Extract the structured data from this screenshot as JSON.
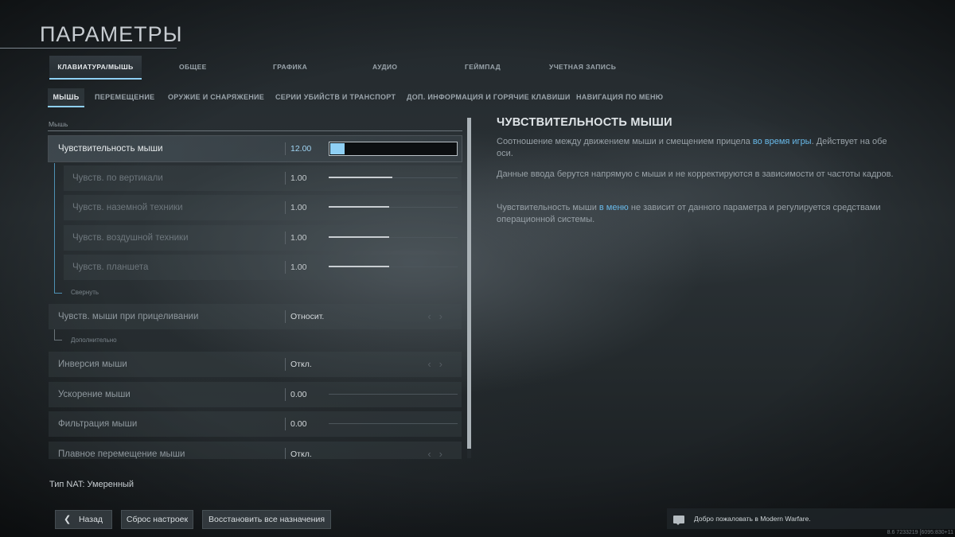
{
  "page_title": "ПАРАМЕТРЫ",
  "tabs": [
    "КЛАВИАТУРА/МЫШЬ",
    "ОБЩЕЕ",
    "ГРАФИКА",
    "АУДИО",
    "ГЕЙМПАД",
    "УЧЕТНАЯ ЗАПИСЬ"
  ],
  "active_tab": "КЛАВИАТУРА/МЫШЬ",
  "subtabs": [
    "МЫШЬ",
    "ПЕРЕМЕЩЕНИЕ",
    "ОРУЖИЕ И СНАРЯЖЕНИЕ",
    "СЕРИИ УБИЙСТВ И ТРАНСПОРТ",
    "ДОП. ИНФОРМАЦИЯ И ГОРЯЧИЕ КЛАВИШИ",
    "НАВИГАЦИЯ ПО МЕНЮ"
  ],
  "active_subtab": "МЫШЬ",
  "section_label": "Мышь",
  "settings": {
    "mouse_sensitivity": {
      "label": "Чувствительность мыши",
      "value": "12.00",
      "level": 0.11
    },
    "vertical": {
      "label": "Чувств. по вертикали",
      "value": "1.00",
      "level": 0.5
    },
    "ground_vehicle": {
      "label": "Чувств. наземной техники",
      "value": "1.00",
      "level": 0.47
    },
    "air_vehicle": {
      "label": "Чувств. воздушной техники",
      "value": "1.00",
      "level": 0.47
    },
    "tablet": {
      "label": "Чувств. планшета",
      "value": "1.00",
      "level": 0.47
    },
    "collapse_label": "Свернуть",
    "ads_sensitivity": {
      "label": "Чувств. мыши при прицеливании",
      "value": "Относит."
    },
    "extra_label": "Дополнительно",
    "invert": {
      "label": "Инверсия мыши",
      "value": "Откл."
    },
    "acceleration": {
      "label": "Ускорение мыши",
      "value": "0.00",
      "level": 0
    },
    "filtering": {
      "label": "Фильтрация мыши",
      "value": "0.00",
      "level": 0
    },
    "smoothing": {
      "label": "Плавное перемещение мыши",
      "value": "Откл."
    }
  },
  "description": {
    "title": "ЧУВСТВИТЕЛЬНОСТЬ МЫШИ",
    "p1_a": "Соотношение между движением мыши и смещением прицела ",
    "p1_hl": "во время игры",
    "p1_b": ". Действует на обе оси.",
    "p2": "Данные ввода берутся напрямую с мыши и не корректируются в зависимости от частоты кадров.",
    "p3_a": "Чувствительность мыши ",
    "p3_hl": "в меню",
    "p3_b": " не зависит от данного параметра и регулируется средствами операционной системы."
  },
  "nat": "Тип NAT: Умеренный",
  "buttons": {
    "back": "Назад",
    "reset": "Сброс настроек",
    "restore": "Восстановить все назначения"
  },
  "welcome": "Добро пожаловать в Modern Warfare.",
  "version": "8.6 7233219 [6095:830+11"
}
